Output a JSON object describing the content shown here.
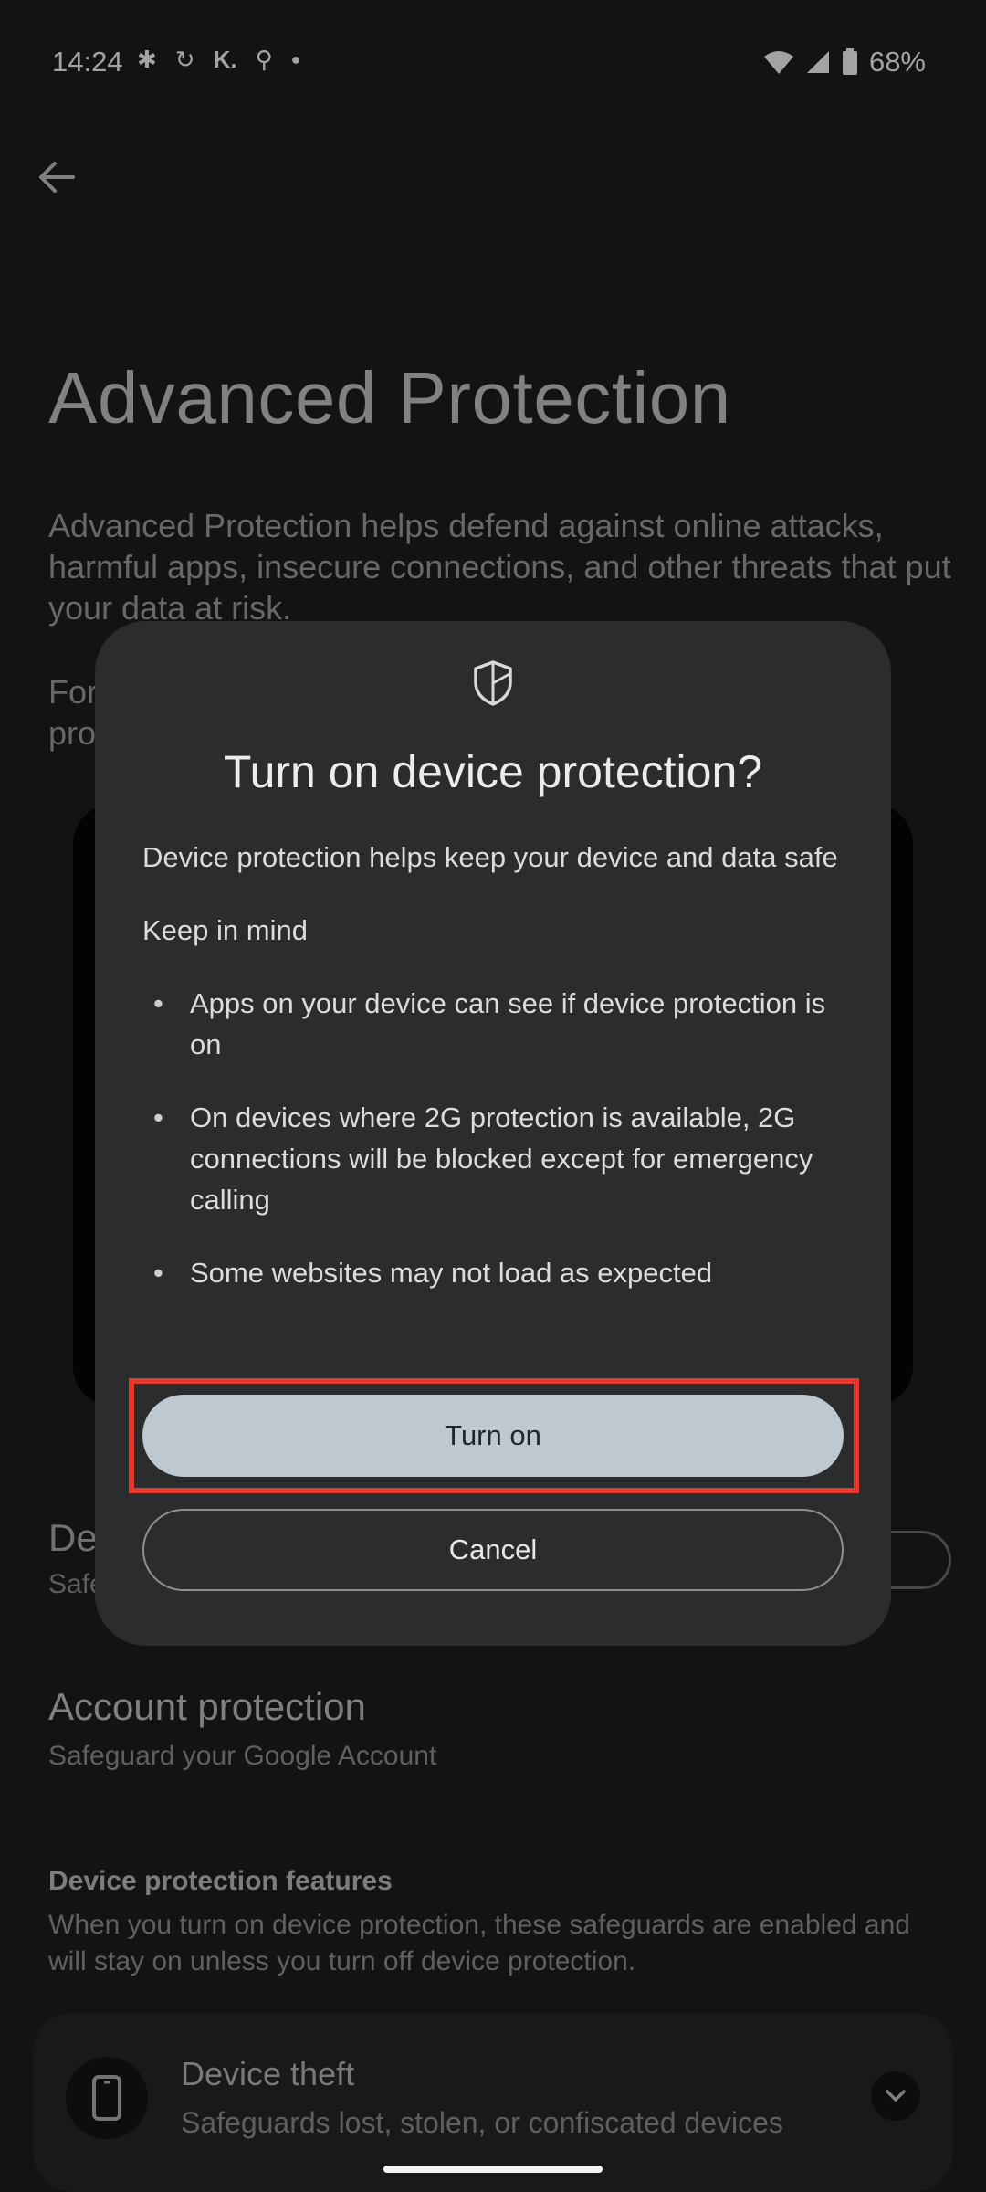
{
  "status_bar": {
    "time": "14:24",
    "left_icons": [
      "slack-icon",
      "sync-icon",
      "k-app-icon",
      "location-icon",
      "dot-icon"
    ],
    "battery": "68%"
  },
  "page": {
    "title": "Advanced Protection",
    "description": "Advanced Protection helps defend against online attacks, harmful apps, insecure connections, and other threats that put your data at risk.",
    "description2_partial": "For\npro",
    "device_row": {
      "title_partial": "De",
      "subtitle_partial": "Safe"
    },
    "account": {
      "title": "Account protection",
      "subtitle": "Safeguard your Google Account"
    },
    "features": {
      "heading": "Device protection features",
      "description": "When you turn on device protection, these safeguards are enabled and will stay on unless you turn off device protection."
    },
    "theft_card": {
      "title": "Device theft",
      "subtitle": "Safeguards lost, stolen, or confiscated devices"
    }
  },
  "dialog": {
    "title": "Turn on device protection?",
    "intro": "Device protection helps keep your device and data safe",
    "keep_in_mind": "Keep in mind",
    "bullets": [
      "Apps on your device can see if device protection is on",
      "On devices where 2G protection is available, 2G connections will be blocked except for emergency calling",
      "Some websites may not load as expected"
    ],
    "primary_button": "Turn on",
    "secondary_button": "Cancel"
  },
  "colors": {
    "background": "#1b1c1c",
    "dialog": "#2b2c2e",
    "primary_button": "#bdc8d0",
    "highlight": "#e4392d"
  }
}
